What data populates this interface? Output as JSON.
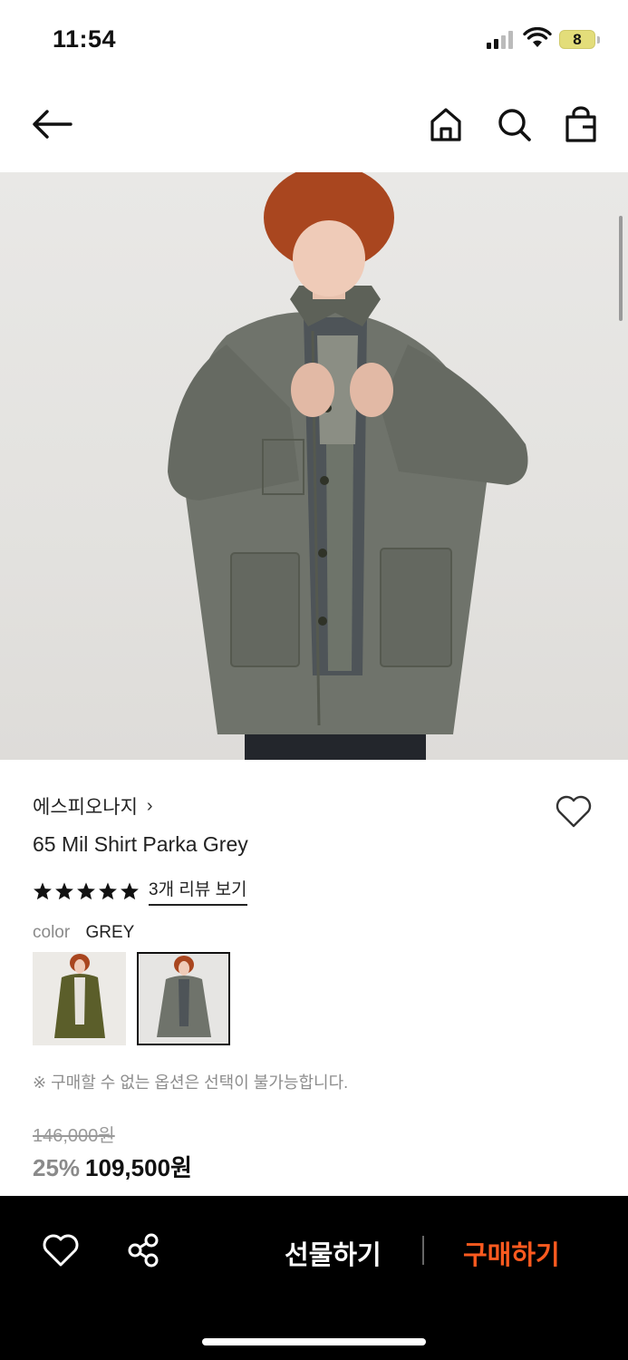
{
  "status_bar": {
    "time": "11:54",
    "battery": "8"
  },
  "nav": {
    "icons": [
      "arrow-left-icon",
      "home-icon",
      "search-icon",
      "bag-icon"
    ]
  },
  "product": {
    "brand": "에스피오나지",
    "brand_chevron": "›",
    "name": "65 Mil Shirt Parka Grey",
    "rating_stars": 5,
    "review_link": "3개 리뷰 보기",
    "color_label": "color",
    "color_value": "GREY",
    "swatches": [
      "olive",
      "grey"
    ],
    "notice": "※ 구매할 수 없는 옵션은 선택이 불가능합니다.",
    "original_price": "146,000원",
    "discount": "25%",
    "price": "109,500원"
  },
  "bottom_bar": {
    "gift_label": "선물하기",
    "buy_label": "구매하기",
    "buy_color": "#ff5a1f"
  }
}
